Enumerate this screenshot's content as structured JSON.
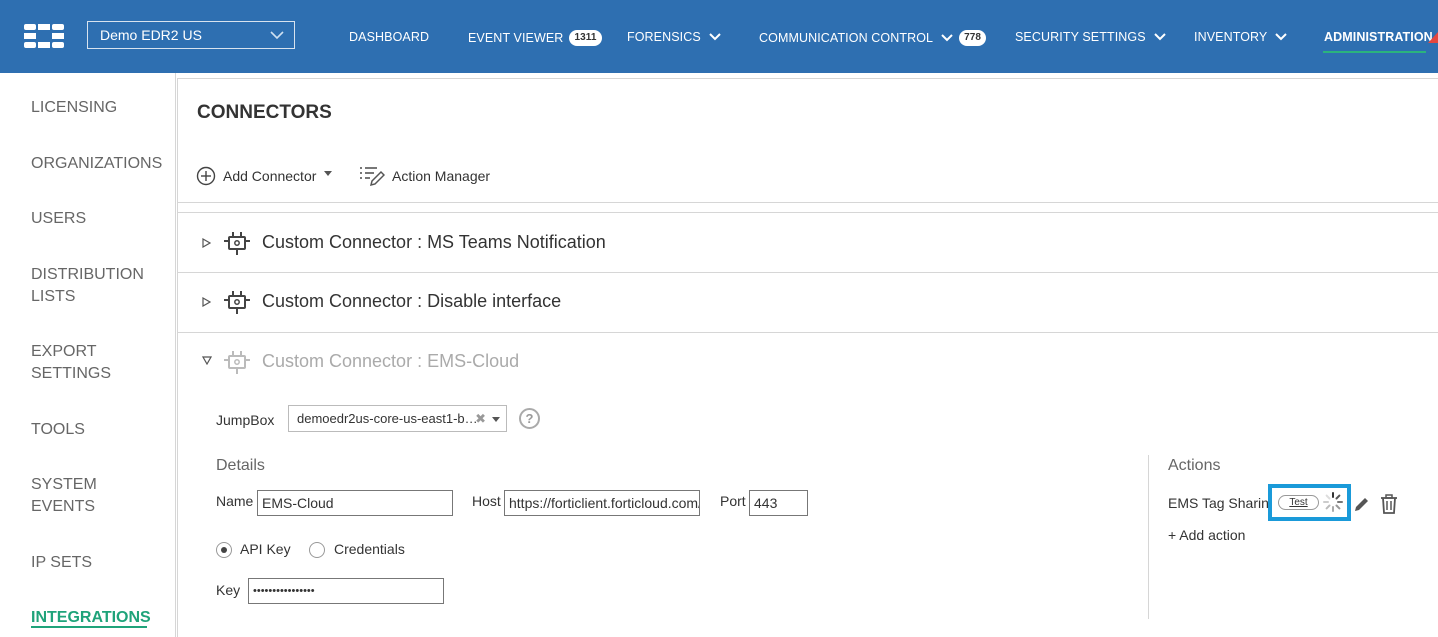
{
  "topbar": {
    "org": "Demo EDR2 US",
    "nav": [
      {
        "label": "DASHBOARD"
      },
      {
        "label": "EVENT VIEWER",
        "badge": "1311"
      },
      {
        "label": "FORENSICS"
      },
      {
        "label": "COMMUNICATION CONTROL",
        "badge": "778"
      },
      {
        "label": "SECURITY SETTINGS"
      },
      {
        "label": "INVENTORY"
      },
      {
        "label": "ADMINISTRATION"
      }
    ]
  },
  "sidebar": {
    "items": [
      {
        "label": "LICENSING"
      },
      {
        "label": "ORGANIZATIONS"
      },
      {
        "label": "USERS"
      },
      {
        "label": "DISTRIBUTION LISTS"
      },
      {
        "label": "EXPORT SETTINGS"
      },
      {
        "label": "TOOLS"
      },
      {
        "label": "SYSTEM EVENTS"
      },
      {
        "label": "IP SETS"
      },
      {
        "label": "INTEGRATIONS"
      }
    ]
  },
  "main": {
    "title": "CONNECTORS",
    "add_connector": "Add Connector",
    "action_manager": "Action Manager",
    "connectors": [
      {
        "label": "Custom Connector : MS Teams Notification"
      },
      {
        "label": "Custom Connector : Disable interface"
      },
      {
        "label": "Custom Connector : EMS-Cloud"
      }
    ],
    "jumpbox_label": "JumpBox",
    "jumpbox_value": "demoedr2us-core-us-east1-b…",
    "details_label": "Details",
    "name_label": "Name",
    "name_value": "EMS-Cloud",
    "host_label": "Host",
    "host_value": "https://forticlient.forticloud.com/",
    "port_label": "Port",
    "port_value": "443",
    "radio_api": "API Key",
    "radio_credentials": "Credentials",
    "key_label": "Key",
    "key_value": "••••••••••••••••",
    "actions_label": "Actions",
    "action_name": "EMS Tag Sharing",
    "test_label": "Test",
    "add_action": "+ Add action"
  },
  "colors": {
    "topbar": "#2e6fb1",
    "active_accent": "#1fa37a",
    "highlight": "#1a9ad9"
  }
}
